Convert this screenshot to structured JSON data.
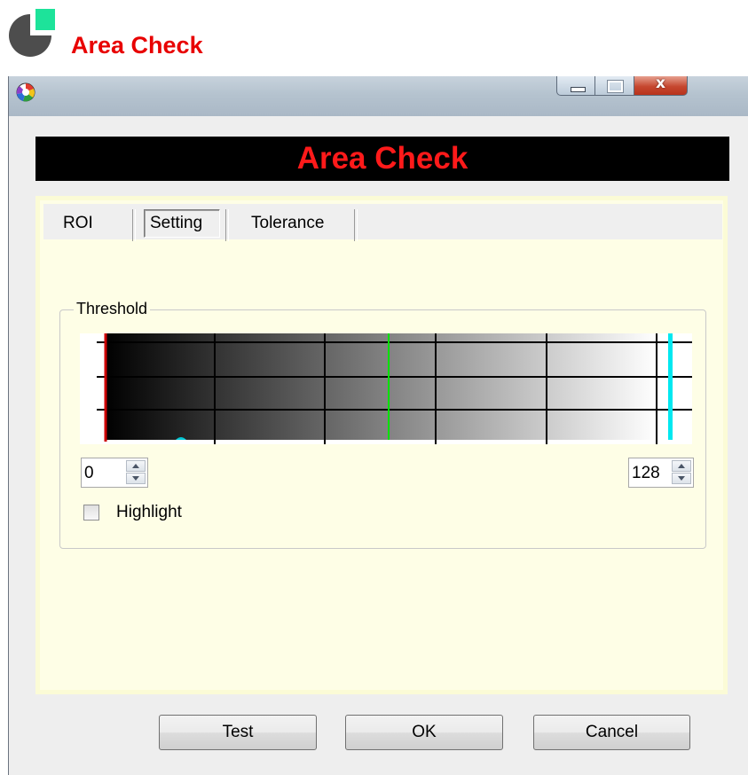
{
  "page": {
    "title": "Area Check"
  },
  "window": {
    "close_glyph": "x",
    "banner_title": "Area Check"
  },
  "tabs": [
    {
      "label": "ROI",
      "active": false
    },
    {
      "label": "Setting",
      "active": true
    },
    {
      "label": "Tolerance",
      "active": false
    }
  ],
  "threshold": {
    "group_label": "Threshold",
    "low_value": "0",
    "high_value": "128",
    "highlight_label": "Highlight",
    "highlight_checked": false
  },
  "buttons": {
    "test": "Test",
    "ok": "OK",
    "cancel": "Cancel"
  },
  "colors": {
    "accent_red": "#e80000",
    "banner_text": "#ff1a1a",
    "panel_background": "#fefee6",
    "low_marker": "#cc0000",
    "mid_marker": "#00e000",
    "high_marker": "#00e8f0",
    "page_icon_gray": "#4d4d4d",
    "page_icon_green": "#1de39a"
  },
  "icons": {
    "page_icon": "pie-chart-icon",
    "app_icon": "color-wheel-icon"
  }
}
